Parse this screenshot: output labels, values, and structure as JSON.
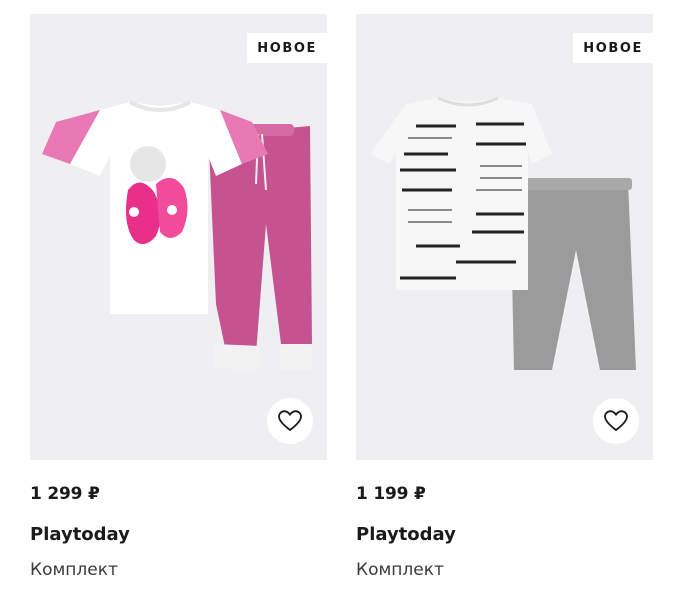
{
  "products": [
    {
      "badge": "НОВОЕ",
      "price": "1 299 ₽",
      "brand": "Playtoday",
      "type": "Комплект",
      "image_icon": "pink-pajama-set-image",
      "favorite_icon": "heart-outline-icon",
      "colors": {
        "top": "#ffffff",
        "sleeves": "#e879b5",
        "pants": "#c4538f"
      }
    },
    {
      "badge": "НОВОЕ",
      "price": "1 199 ₽",
      "brand": "Playtoday",
      "type": "Комплект",
      "image_icon": "graphic-tee-gray-leggings-image",
      "favorite_icon": "heart-outline-icon",
      "colors": {
        "top": "#f7f7f7",
        "print": "#222222",
        "leggings": "#9b9b9b"
      }
    }
  ]
}
